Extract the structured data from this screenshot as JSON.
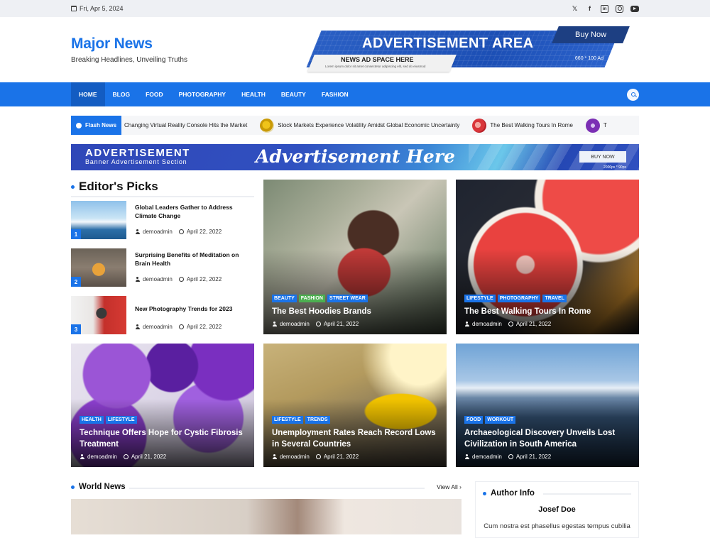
{
  "topbar": {
    "date": "Fri, Apr 5, 2024",
    "socials": [
      "x-icon",
      "facebook-icon",
      "linkedin-icon",
      "instagram-icon",
      "youtube-icon"
    ]
  },
  "header": {
    "site_title": "Major News",
    "tagline": "Breaking Headlines, Unveiling Truths",
    "ad": {
      "title": "ADVERTISEMENT AREA",
      "buy_label": "Buy Now",
      "sub_label": "NEWS AD SPACE HERE",
      "size_label": "660 * 100 Ad",
      "fine_print": "Lorem ipsum dolor sit amet consectetur adipiscing elit, sed do eiusmod"
    }
  },
  "nav": {
    "items": [
      "HOME",
      "BLOG",
      "FOOD",
      "PHOTOGRAPHY",
      "HEALTH",
      "BEAUTY",
      "FASHION"
    ],
    "active": "HOME"
  },
  "ticker": {
    "label": "Flash News",
    "items": [
      "Changing Virtual Reality Console Hits the Market",
      "Stock Markets Experience Volatility Amidst Global Economic Uncertainty",
      "The Best Walking Tours In Rome",
      "T"
    ]
  },
  "banner": {
    "left_title": "ADVERTISEMENT",
    "left_sub": "Banner Advertisement Section",
    "headline": "Advertisement Here",
    "buy_label": "BUY NOW",
    "size_label": "2000px * 90px"
  },
  "editors_picks": {
    "title": "Editor's Picks",
    "items": [
      {
        "num": "1",
        "title": "Global Leaders Gather to Address Climate Change",
        "author": "demoadmin",
        "date": "April 22, 2022"
      },
      {
        "num": "2",
        "title": "Surprising Benefits of Meditation on Brain Health",
        "author": "demoadmin",
        "date": "April 22, 2022"
      },
      {
        "num": "3",
        "title": "New Photography Trends for 2023",
        "author": "demoadmin",
        "date": "April 22, 2022"
      }
    ]
  },
  "cards": [
    {
      "tags": [
        "BEAUTY",
        "FASHION",
        "STREET WEAR"
      ],
      "title": "The Best Hoodies Brands",
      "author": "demoadmin",
      "date": "April 21, 2022"
    },
    {
      "tags": [
        "LIFESTYLE",
        "PHOTOGRAPHY",
        "TRAVEL"
      ],
      "title": "The Best Walking Tours In Rome",
      "author": "demoadmin",
      "date": "April 21, 2022"
    },
    {
      "tags": [
        "HEALTH",
        "LIFESTYLE"
      ],
      "title": "Technique Offers Hope for Cystic Fibrosis Treatment",
      "author": "demoadmin",
      "date": "April 21, 2022"
    },
    {
      "tags": [
        "LIFESTYLE",
        "TRENDS"
      ],
      "title": "Unemployment Rates Reach Record Lows in Several Countries",
      "author": "demoadmin",
      "date": "April 21, 2022"
    },
    {
      "tags": [
        "FOOD",
        "WORKOUT"
      ],
      "title": "Archaeological Discovery Unveils Lost Civilization in South America",
      "author": "demoadmin",
      "date": "April 21, 2022"
    }
  ],
  "world_news": {
    "title": "World News",
    "view_all": "View All"
  },
  "author_info": {
    "title": "Author Info",
    "name": "Josef Doe",
    "bio": "Cum nostra est phasellus egestas tempus cubilia"
  },
  "colors": {
    "accent": "#1a73e8",
    "tag_green": "#4caf50",
    "tag_blue": "#1a73e8",
    "tag_darkblue": "#1c55b8"
  }
}
